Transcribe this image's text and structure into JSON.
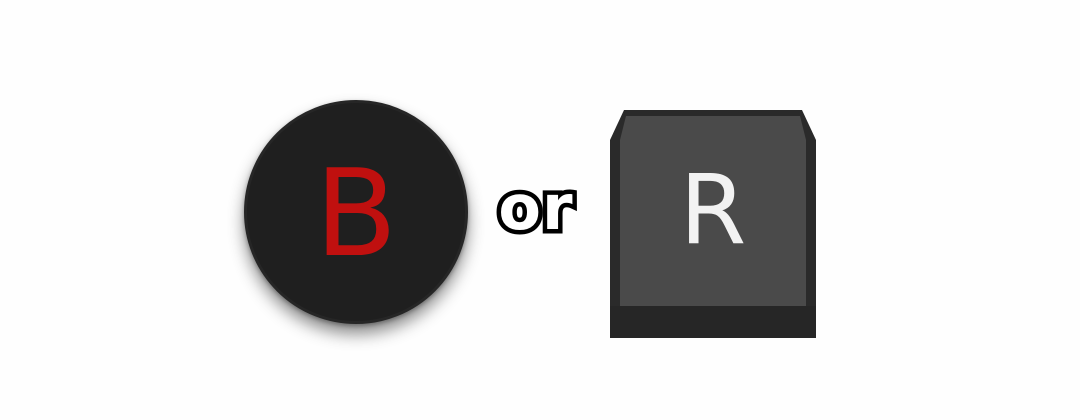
{
  "gamepad_button": {
    "label": "B",
    "face_color": "#1f1f1f",
    "letter_color": "#c0100f"
  },
  "separator": {
    "text": "or"
  },
  "keyboard_key": {
    "label": "R",
    "top_color": "#4a4a4a",
    "side_color": "#2a2a2a"
  }
}
